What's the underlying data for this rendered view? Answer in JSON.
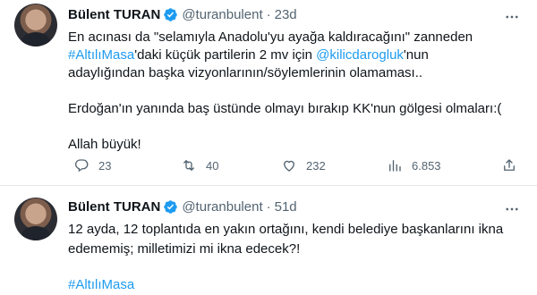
{
  "tweets": [
    {
      "author_name": "Bülent TURAN",
      "handle": "@turanbulent",
      "separator": "·",
      "time": "23d",
      "lines": [
        {
          "text": "En acınası da \"selamıyla Anadolu'yu ayağa kaldıracağını\" zanneden"
        },
        {
          "hashtag": "#AltılıMasa",
          "text_after_hashtag": "'daki küçük partilerin 2 mv için ",
          "mention": "@kilicdarogluk",
          "text_after_mention": "'nun"
        },
        {
          "text": "adaylığından başka vizyonlarının/söylemlerinin olamaması.."
        },
        {
          "text": "Erdoğan'ın yanında baş üstünde olmayı bırakıp KK'nun gölgesi olmaları:("
        },
        {
          "text": "Allah büyük!"
        }
      ],
      "actions": {
        "reply_count": "23",
        "retweet_count": "40",
        "like_count": "232",
        "view_count": "6.853"
      }
    },
    {
      "author_name": "Bülent TURAN",
      "handle": "@turanbulent",
      "separator": "·",
      "time": "51d",
      "lines": [
        {
          "text": "12 ayda, 12 toplantıda en yakın ortağını, kendi belediye başkanlarını ikna"
        },
        {
          "text": "edememiş; milletimizi mi ikna edecek?!"
        },
        {
          "hashtag": "#AltılıMasa"
        }
      ]
    }
  ],
  "icons": {
    "verified": "verified-badge-icon",
    "more": "more-icon",
    "reply": "reply-icon",
    "retweet": "retweet-icon",
    "like": "heart-icon",
    "views": "views-icon",
    "share": "share-icon"
  },
  "colors": {
    "accent": "#1d9bf0",
    "text": "#0f1419",
    "secondary": "#536471",
    "divider": "#e4e8eb"
  }
}
